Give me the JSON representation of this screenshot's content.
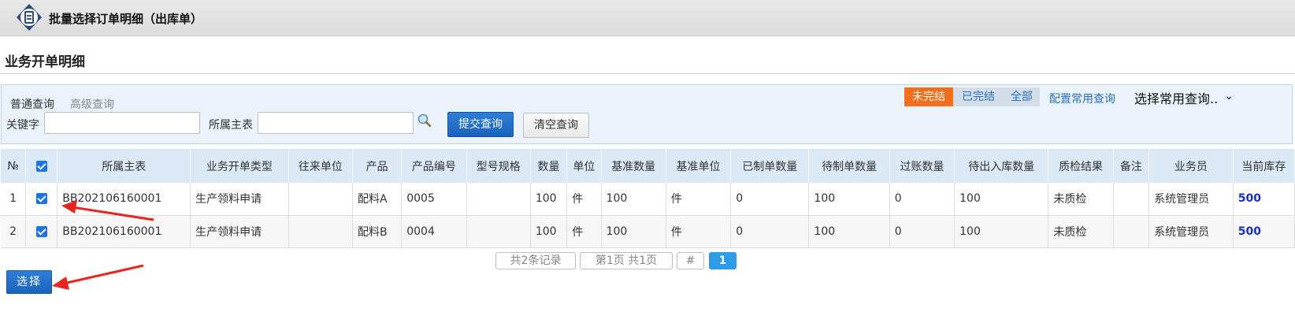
{
  "window": {
    "title": "批量选择订单明细（出库单）",
    "logo_icon": "document-icon"
  },
  "section": {
    "title": "业务开单明细"
  },
  "query": {
    "tabs": [
      "普通查询",
      "高级查询"
    ],
    "keyword_label": "关键字",
    "keyword_value": "",
    "owner_label": "所属主表",
    "owner_value": "",
    "submit_label": "提交查询",
    "clear_label": "清空查询",
    "status_filters": [
      "未完结",
      "已完结",
      "全部"
    ],
    "active_status": "未完结",
    "config_link": "配置常用查询",
    "common_query_select": "选择常用查询.."
  },
  "table": {
    "columns": [
      "№",
      "",
      "所属主表",
      "业务开单类型",
      "往来单位",
      "产品",
      "产品编号",
      "型号规格",
      "数量",
      "单位",
      "基准数量",
      "基准单位",
      "已制单数量",
      "待制单数量",
      "过账数量",
      "待出入库数量",
      "质检结果",
      "备注",
      "业务员",
      "当前库存"
    ],
    "rows": [
      {
        "no": "1",
        "checked": true,
        "master": "BB202106160001",
        "type": "生产领料申请",
        "partner": "",
        "product": "配料A",
        "code": "0005",
        "spec": "",
        "qty": "100",
        "unit": "件",
        "base_qty": "100",
        "base_unit": "件",
        "made": "0",
        "to_make": "100",
        "posted": "0",
        "pending": "100",
        "qc": "未质检",
        "remark": "",
        "staff": "系统管理员",
        "stock": "500"
      },
      {
        "no": "2",
        "checked": true,
        "master": "BB202106160001",
        "type": "生产领料申请",
        "partner": "",
        "product": "配料B",
        "code": "0004",
        "spec": "",
        "qty": "100",
        "unit": "件",
        "base_qty": "100",
        "base_unit": "件",
        "made": "0",
        "to_make": "100",
        "posted": "0",
        "pending": "100",
        "qc": "未质检",
        "remark": "",
        "staff": "系统管理员",
        "stock": "500"
      }
    ]
  },
  "pager": {
    "total": "共2条记录",
    "pages": "第1页 共1页",
    "hash": "#",
    "current": "1"
  },
  "actions": {
    "select_label": "选择"
  },
  "colors": {
    "accent": "#1a63bd",
    "status_active": "#f36f1c",
    "stock": "#1a2fc8",
    "arrow": "#e8261f"
  }
}
